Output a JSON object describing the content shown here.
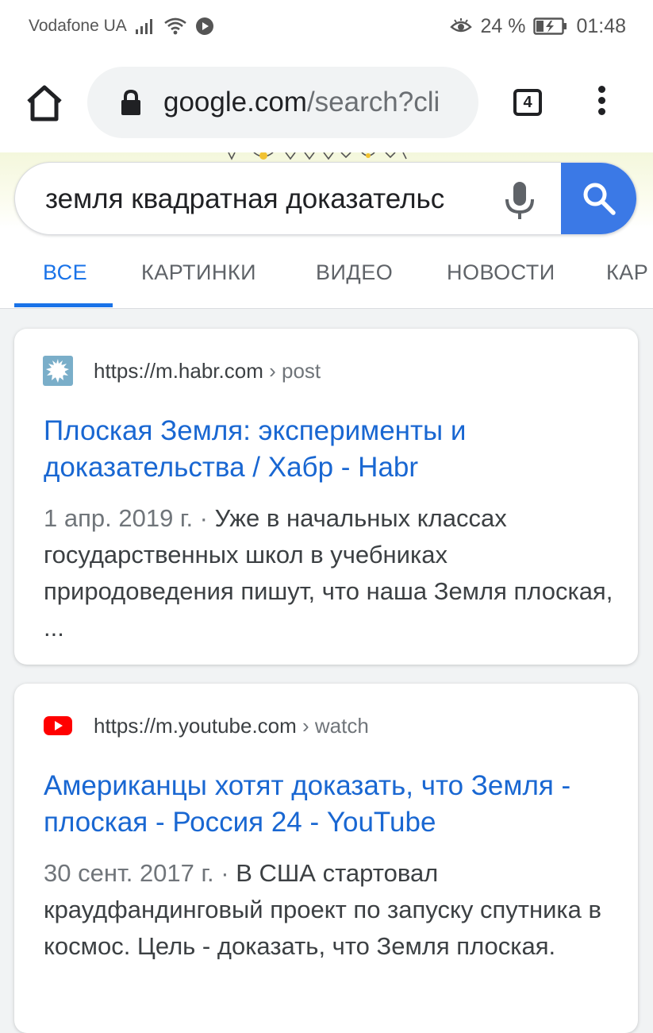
{
  "status_bar": {
    "carrier": "Vodafone UA",
    "battery": "24 %",
    "time": "01:48"
  },
  "browser": {
    "url_domain": "google.com",
    "url_path": "/search?cli",
    "tab_count": "4"
  },
  "search": {
    "query": "земля квадратная доказательс",
    "tabs": [
      "ВСЕ",
      "КАРТИНКИ",
      "ВИДЕО",
      "НОВОСТИ",
      "КАР"
    ]
  },
  "results": [
    {
      "site": "https://m.habr.com",
      "path": " › post",
      "title": "Плоская Земля: эксперименты и доказательства / Хабр - Habr",
      "date": "1 апр. 2019 г. · ",
      "snippet": "Уже в начальных классах государственных школ в учебниках природоведения пишут, что наша Земля плоская, ..."
    },
    {
      "site": "https://m.youtube.com",
      "path": " › watch",
      "title": "Американцы хотят доказать, что Земля - плоская - Россия 24 - YouTube",
      "date": "30 сент. 2017 г. · ",
      "snippet": "В США стартовал краудфандинговый проект по запуску спутника в космос. Цель - доказать, что Земля плоская."
    }
  ],
  "colors": {
    "accent": "#1a73e8",
    "link": "#1967d2",
    "search_button": "#3b79e6",
    "youtube_red": "#ff0000"
  },
  "icons": [
    "signal-icon",
    "wifi-icon",
    "play-icon",
    "eye-icon",
    "battery-icon",
    "home-icon",
    "lock-icon",
    "tabs-icon",
    "menu-icon",
    "mic-icon",
    "search-icon",
    "habr-favicon",
    "youtube-favicon"
  ]
}
